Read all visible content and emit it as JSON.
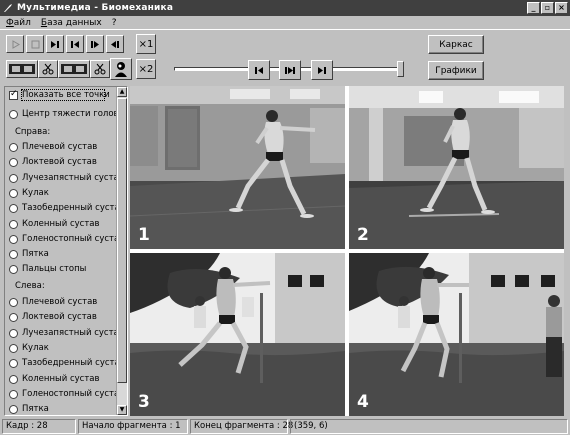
{
  "window": {
    "title": "Мультимедиа - Биомеханика"
  },
  "menu": {
    "items": [
      "Файл",
      "База данных",
      "?"
    ]
  },
  "toolbar": {
    "zoom1_label": "×1",
    "zoom2_label": "×2"
  },
  "slider": {
    "min_label": "1",
    "max_label": "28",
    "value": 28
  },
  "buttons": {
    "karkas": "Каркас",
    "grafiki": "Графики"
  },
  "panel": {
    "show_all": "Показать все точки",
    "head_center": "Центр тяжести головы",
    "right_group": "Справа:",
    "left_group": "Слева:",
    "right_items": [
      "Плечевой сустав",
      "Локтевой сустав",
      "Лучезапястный сустав",
      "Кулак",
      "Тазобедренный сустав",
      "Коленный сустав",
      "Голеностопный сустав",
      "Пятка",
      "Пальцы стопы"
    ],
    "left_items": [
      "Плечевой сустав",
      "Локтевой сустав",
      "Лучезапястный сустав",
      "Кулак",
      "Тазобедренный сустав",
      "Коленный сустав",
      "Голеностопный сустав",
      "Пятка"
    ]
  },
  "photos": {
    "numbers": [
      "1",
      "2",
      "3",
      "4"
    ]
  },
  "status": {
    "frame": "Кадр : 28",
    "start": "Начало фрагмента : 1",
    "end": "Конец фрагмента : 28",
    "coords": "(359, 6)"
  }
}
